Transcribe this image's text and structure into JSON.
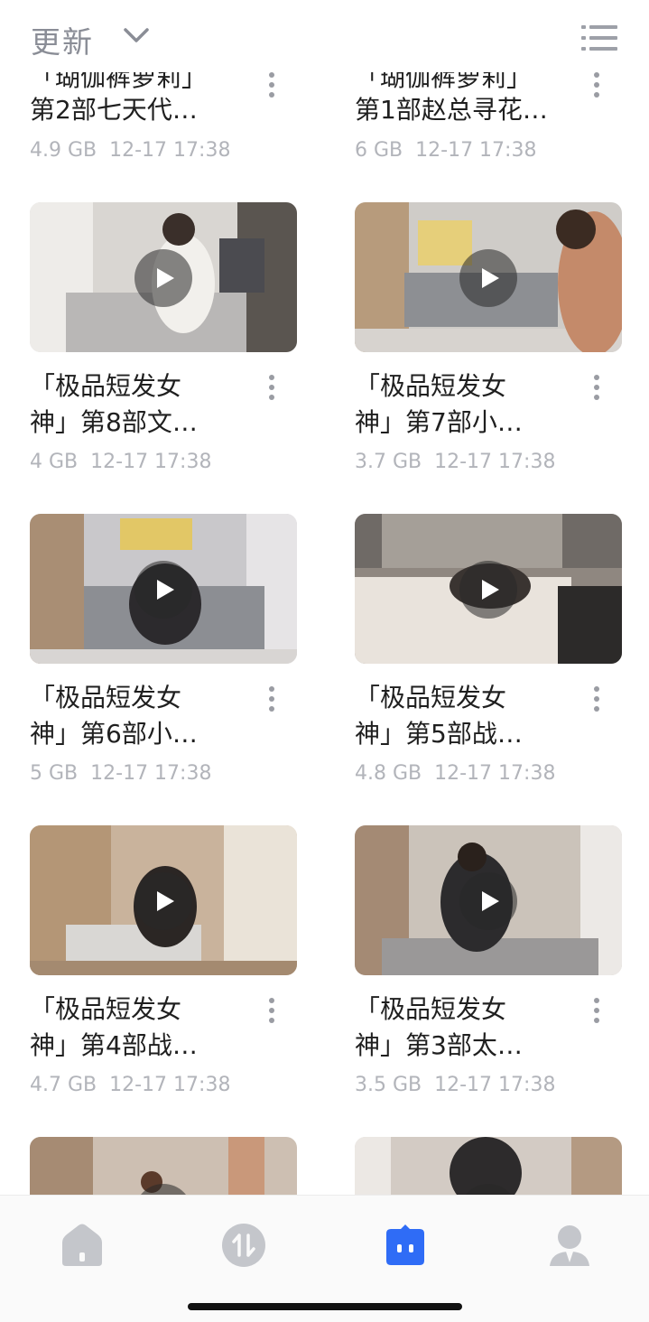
{
  "header": {
    "sort_label": "更新",
    "sort_icon": "chevron-down-icon",
    "view_icon": "list-view-icon"
  },
  "items": [
    {
      "title_line1": "「瑚伽裤萝莉」",
      "title_line2": "第2部七天代…",
      "size": "4.9 GB",
      "time": "12-17 17:38"
    },
    {
      "title_line1": "「瑚伽裤萝莉」",
      "title_line2": "第1部赵总寻花…",
      "size": "6 GB",
      "time": "12-17 17:38"
    },
    {
      "title_line1": "「极品短发女",
      "title_line2": "神」第8部文…",
      "size": "4 GB",
      "time": "12-17 17:38"
    },
    {
      "title_line1": "「极品短发女",
      "title_line2": "神」第7部小…",
      "size": "3.7 GB",
      "time": "12-17 17:38"
    },
    {
      "title_line1": "「极品短发女",
      "title_line2": "神」第6部小…",
      "size": "5 GB",
      "time": "12-17 17:38"
    },
    {
      "title_line1": "「极品短发女",
      "title_line2": "神」第5部战…",
      "size": "4.8 GB",
      "time": "12-17 17:38"
    },
    {
      "title_line1": "「极品短发女",
      "title_line2": "神」第4部战…",
      "size": "4.7 GB",
      "time": "12-17 17:38"
    },
    {
      "title_line1": "「极品短发女",
      "title_line2": "神」第3部太…",
      "size": "3.5 GB",
      "time": "12-17 17:38"
    }
  ],
  "nav": [
    {
      "icon": "home-icon",
      "active": false
    },
    {
      "icon": "transfer-icon",
      "active": false
    },
    {
      "icon": "files-icon",
      "active": true
    },
    {
      "icon": "profile-icon",
      "active": false
    }
  ],
  "colors": {
    "accent": "#2f6cf6",
    "muted": "#b2b4ba",
    "icon_gray": "#c4c6cb"
  }
}
